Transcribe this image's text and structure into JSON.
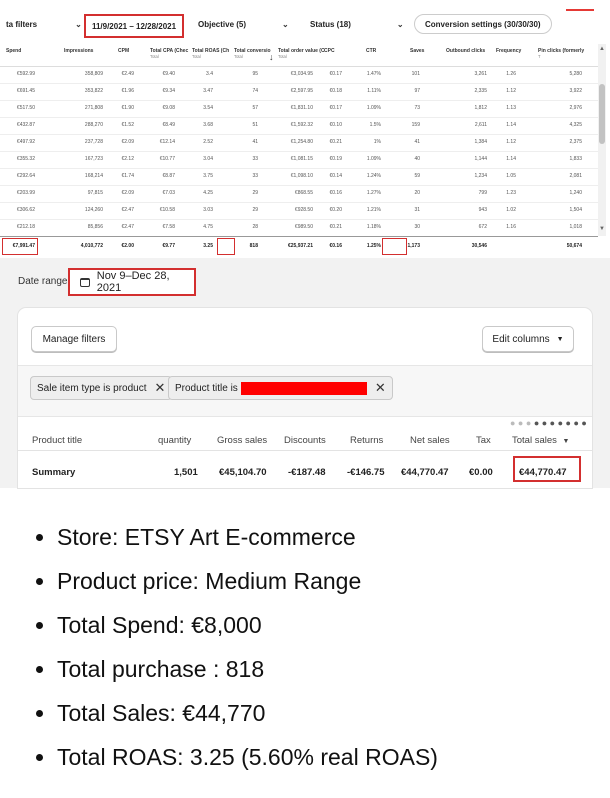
{
  "ads_report": {
    "toolbar": {
      "filters_label": "ta filters",
      "date_range": "11/9/2021 – 12/28/2021",
      "objective": "Objective (5)",
      "status": "Status (18)",
      "conversion_settings": "Conversion settings (30/30/30)"
    },
    "columns": [
      {
        "label": "Spend",
        "sub": ""
      },
      {
        "label": "Impressions",
        "sub": ""
      },
      {
        "label": "CPM",
        "sub": ""
      },
      {
        "label": "Total CPA (Chec",
        "sub": "Total"
      },
      {
        "label": "Total ROAS (Ch",
        "sub": "Total"
      },
      {
        "label": "Total conversio",
        "sub": "Total"
      },
      {
        "label": "Total order value (C",
        "sub": "Total"
      },
      {
        "label": "CPC",
        "sub": ""
      },
      {
        "label": "CTR",
        "sub": ""
      },
      {
        "label": "Saves",
        "sub": ""
      },
      {
        "label": "Outbound clicks",
        "sub": ""
      },
      {
        "label": "Frequency",
        "sub": ""
      },
      {
        "label": "Pin clicks (formerly",
        "sub": "T"
      }
    ],
    "rows": [
      [
        "€592.99",
        "358,809",
        "€2.49",
        "€9.40",
        "3.4",
        "95",
        "€3,034.95",
        "€0.17",
        "1.47%",
        "101",
        "3,261",
        "1.26",
        "5,280"
      ],
      [
        "€691.45",
        "353,822",
        "€1.96",
        "€9.34",
        "3.47",
        "74",
        "€2,597.95",
        "€0.18",
        "1.11%",
        "97",
        "2,335",
        "1.12",
        "3,922"
      ],
      [
        "€517.50",
        "271,808",
        "€1.90",
        "€9.08",
        "3.54",
        "57",
        "€1,831.10",
        "€0.17",
        "1.09%",
        "73",
        "1,812",
        "1.13",
        "2,976"
      ],
      [
        "€432.87",
        "288,270",
        "€1.52",
        "€8.49",
        "3.68",
        "51",
        "€1,592.32",
        "€0.10",
        "1.5%",
        "159",
        "2,611",
        "1.14",
        "4,325"
      ],
      [
        "€497.92",
        "237,728",
        "€2.09",
        "€12.14",
        "2.52",
        "41",
        "€1,254.80",
        "€0.21",
        "1%",
        "41",
        "1,384",
        "1.12",
        "2,375"
      ],
      [
        "€355.32",
        "167,723",
        "€2.12",
        "€10.77",
        "3.04",
        "33",
        "€1,081.15",
        "€0.19",
        "1.09%",
        "40",
        "1,144",
        "1.14",
        "1,833"
      ],
      [
        "€292.64",
        "168,214",
        "€1.74",
        "€8.87",
        "3.75",
        "33",
        "€1,098.10",
        "€0.14",
        "1.24%",
        "59",
        "1,234",
        "1.05",
        "2,081"
      ],
      [
        "€203.99",
        "97,815",
        "€2.09",
        "€7.03",
        "4.25",
        "29",
        "€868.55",
        "€0.16",
        "1.27%",
        "20",
        "799",
        "1.23",
        "1,240"
      ],
      [
        "€306.62",
        "124,260",
        "€2.47",
        "€10.58",
        "3.03",
        "29",
        "€928.50",
        "€0.20",
        "1.21%",
        "31",
        "943",
        "1.02",
        "1,504"
      ],
      [
        "€212.18",
        "85,856",
        "€2.47",
        "€7.58",
        "4.75",
        "28",
        "€989.50",
        "€0.21",
        "1.18%",
        "30",
        "672",
        "1.16",
        "1,018"
      ]
    ],
    "totals": [
      "€7,991.47",
      "4,010,772",
      "€2.00",
      "€9.77",
      "3.25",
      "818",
      "€25,937.21",
      "€0.16",
      "1.25%",
      "1,173",
      "30,546",
      "",
      "50,674"
    ]
  },
  "shop_report": {
    "date_range_label": "Date range",
    "date_range_value": "Nov 9–Dec 28, 2021",
    "manage_filters": "Manage filters",
    "edit_columns": "Edit columns",
    "chips": [
      {
        "text": "Sale item type is product"
      },
      {
        "text": "Product title is"
      }
    ],
    "headers": {
      "product_title": "Product title",
      "quantity": "quantity",
      "gross_sales": "Gross sales",
      "discounts": "Discounts",
      "returns": "Returns",
      "net_sales": "Net sales",
      "tax": "Tax",
      "total_sales": "Total sales"
    },
    "summary": {
      "label": "Summary",
      "quantity": "1,501",
      "gross_sales": "€45,104.70",
      "discounts": "-€187.48",
      "returns": "-€146.75",
      "net_sales": "€44,770.47",
      "tax": "€0.00",
      "total_sales": "€44,770.47"
    }
  },
  "bullets": [
    "Store: ETSY Art E-commerce",
    "Product price: Medium Range",
    "Total Spend: €8,000",
    "Total purchase : 818",
    "Total Sales: €44,770",
    "Total ROAS: 3.25 (5.60% real ROAS)"
  ]
}
